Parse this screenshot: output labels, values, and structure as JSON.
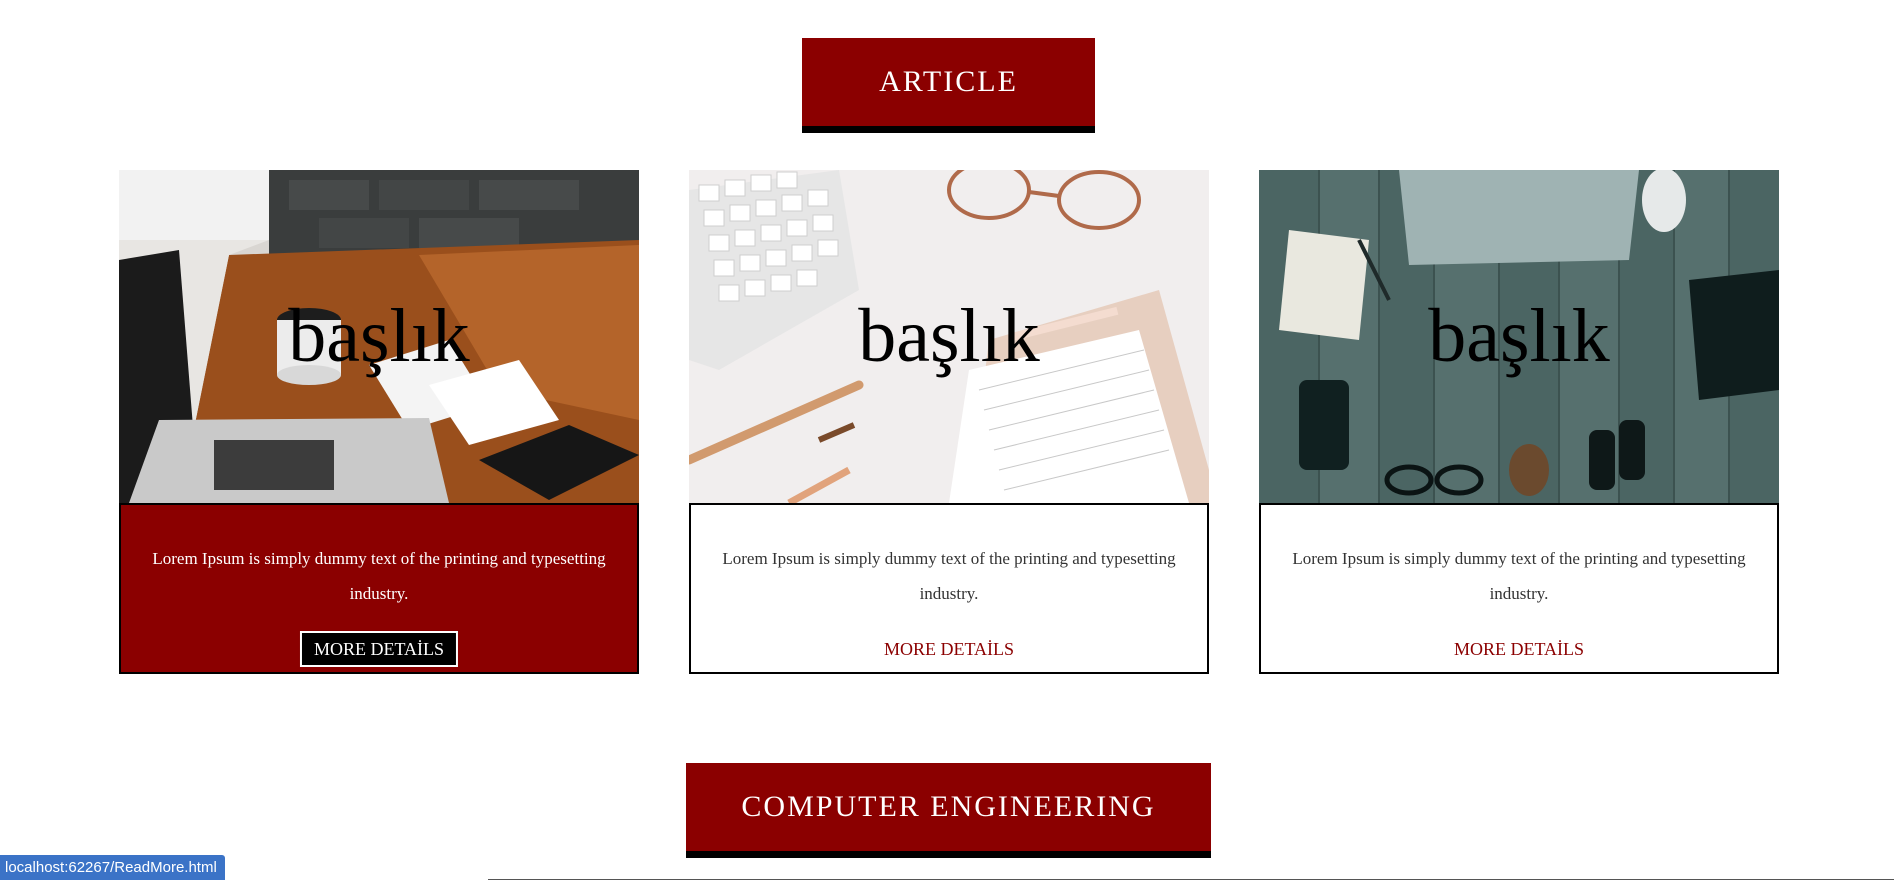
{
  "sections": {
    "article_label": "ARTICLE",
    "computer_engineering_label": "COMPUTER ENGINEERING"
  },
  "cards": [
    {
      "title": "başlık",
      "text": "Lorem Ipsum is simply dummy text of the printing and typesetting industry.",
      "button_label": "MORE DETAİLS",
      "image": "laptop-coffee-desk"
    },
    {
      "title": "başlık",
      "text": "Lorem Ipsum is simply dummy text of the printing and typesetting industry.",
      "button_label": "MORE DETAİLS",
      "image": "keyboard-glasses-notebook"
    },
    {
      "title": "başlık",
      "text": "Lorem Ipsum is simply dummy text of the printing and typesetting industry.",
      "button_label": "MORE DETAİLS",
      "image": "wooden-desk-flatlay"
    }
  ],
  "status_bar": {
    "link_preview": "localhost:62267/ReadMore.html"
  },
  "colors": {
    "accent": "#8b0000",
    "status_bar": "#3b73c7"
  }
}
